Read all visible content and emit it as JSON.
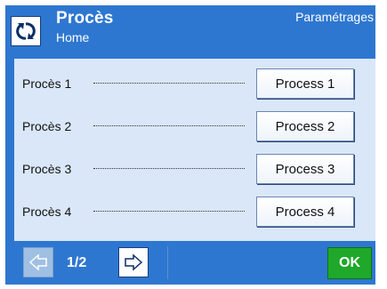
{
  "header": {
    "title": "Procès",
    "subtitle": "Home",
    "settings_label": "Paramétrages",
    "icon": "refresh-icon"
  },
  "rows": [
    {
      "label": "Procès 1",
      "value": "Process 1"
    },
    {
      "label": "Procès 2",
      "value": "Process 2"
    },
    {
      "label": "Procès 3",
      "value": "Process 3"
    },
    {
      "label": "Procès 4",
      "value": "Process 4"
    }
  ],
  "footer": {
    "page": "1/2",
    "ok_label": "OK",
    "prev_icon": "arrow-left-icon",
    "next_icon": "arrow-right-icon"
  },
  "colors": {
    "primary": "#2E77D0",
    "content_bg": "#D9E7F8",
    "ok": "#1FA82A"
  }
}
